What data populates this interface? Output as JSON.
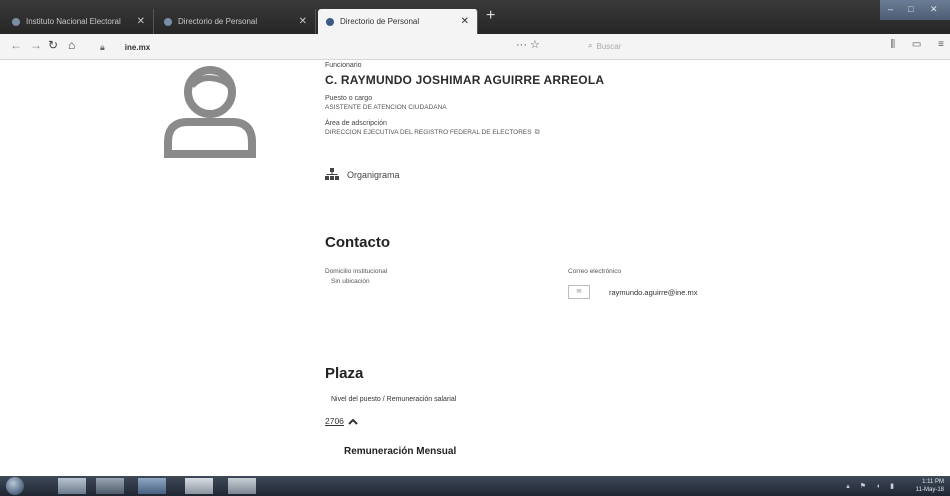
{
  "browser": {
    "tabs": [
      {
        "label": "Instituto Nacional Electoral",
        "active": false
      },
      {
        "label": "Directorio de Personal",
        "active": false
      },
      {
        "label": "Directorio de Personal",
        "active": true
      }
    ],
    "url_domain": "ine.mx",
    "search_placeholder": "Buscar",
    "colors": {
      "tabbar": "#2e2e2e",
      "toolbar": "#f4f4f4",
      "accent": "#3b5b86"
    }
  },
  "profile": {
    "role_label": "Funcionario",
    "name": "C. RAYMUNDO JOSHIMAR AGUIRRE ARREOLA",
    "position_label": "Puesto o cargo",
    "position": "ASISTENTE DE ATENCION CIUDADANA",
    "area_label": "Área de adscripción",
    "area": "DIRECCION EJECUTIVA DEL REGISTRO FEDERAL DE ELECTORES",
    "org_chart_label": "Organigrama"
  },
  "contact": {
    "title": "Contacto",
    "address_label": "Domicilio institucional",
    "address_value": "Sin ubicación",
    "email_label": "Correo electrónico",
    "email": "raymundo.aguirre@ine.mx"
  },
  "plaza": {
    "title": "Plaza",
    "level_label": "Nivel del puesto / Remuneración salarial",
    "level_value": "2706",
    "remuneration_title": "Remuneración Mensual"
  },
  "taskbar": {
    "time": "1:11 PM",
    "date": "11-May-18"
  },
  "icons": {
    "avatar": "user-avatar-icon",
    "org_chart": "org-chart-icon",
    "email": "envelope-icon",
    "external_link": "external-link-icon",
    "caret": "chevron-up-icon"
  }
}
